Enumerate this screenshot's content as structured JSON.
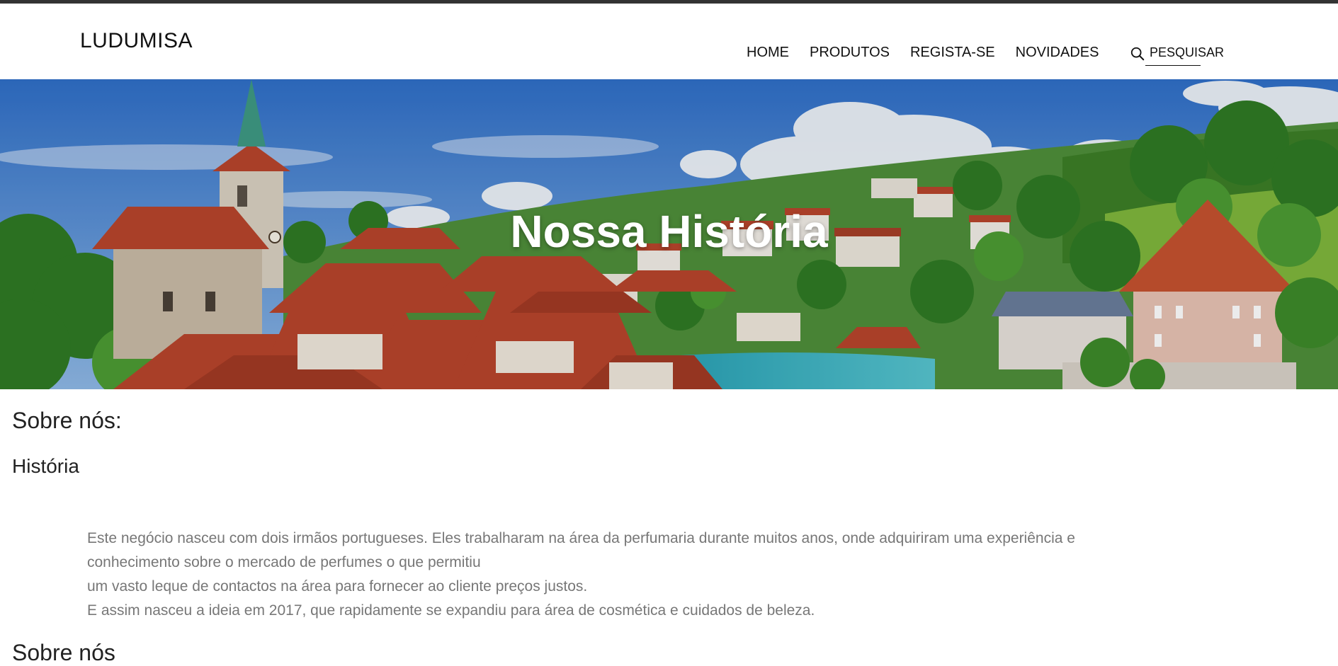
{
  "brand": {
    "logo": "LUDUMISA"
  },
  "nav": {
    "items": [
      {
        "label": "HOME"
      },
      {
        "label": "PRODUTOS"
      },
      {
        "label": "REGISTA-SE"
      },
      {
        "label": "NOVIDADES"
      }
    ],
    "search_label": "PESQUISAR",
    "search_icon": "search-icon"
  },
  "hero": {
    "title": "Nossa História",
    "image_description_icon": "city-landscape-image"
  },
  "content": {
    "heading": "Sobre nós:",
    "subheading": "História",
    "paragraph_lines": [
      "Este negócio nasceu com dois irmãos portugueses. Eles trabalharam na área da perfumaria durante muitos anos, onde adquiriram uma experiência e",
      "conhecimento sobre o mercado de perfumes o que permitiu",
      "um vasto leque de contactos na área para fornecer ao cliente preços justos.",
      "E assim nasceu a ideia em 2017, que rapidamente se expandiu para área de cosmética e cuidados de beleza."
    ],
    "next_heading": "Sobre nós"
  },
  "colors": {
    "topstrip": "#333333",
    "text": "#111111",
    "paragraph": "#777777",
    "roof": "#b8452c",
    "sky": "#3f7fd0",
    "river": "#3ab3c4",
    "trees": "#3d8a2a"
  }
}
